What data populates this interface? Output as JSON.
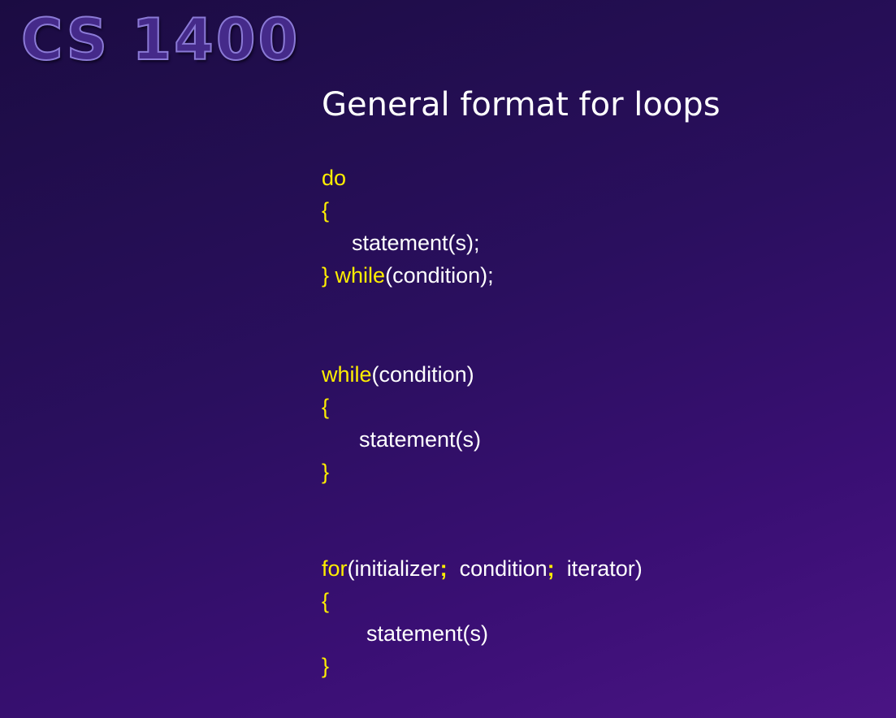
{
  "slide": {
    "course_logo": "CS 1400",
    "title": "General format for loops"
  },
  "do_while": {
    "kw_do": "do",
    "open_brace": "{",
    "body": "statement(s);",
    "close_brace": "}",
    "kw_while": "while",
    "condition": "(condition);"
  },
  "while_loop": {
    "kw_while": "while",
    "condition": "(condition)",
    "open_brace": "{",
    "body": "statement(s)",
    "close_brace": "}"
  },
  "for_loop": {
    "kw_for": "for",
    "open_paren": "(",
    "initializer": "initializer",
    "semi1": ";",
    "condition": "condition",
    "semi2": ";",
    "iterator": "iterator)",
    "open_brace": "{",
    "body": "statement(s)",
    "close_brace": "}"
  },
  "colors": {
    "keyword": "#ffee00",
    "text": "#ffffff",
    "background": "#2a0f5e"
  }
}
